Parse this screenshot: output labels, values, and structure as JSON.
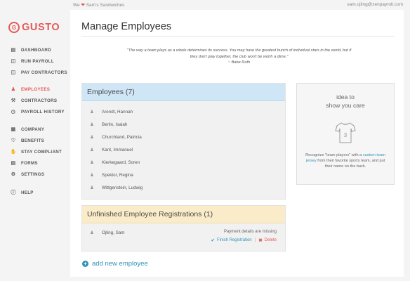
{
  "topbar": {
    "company_prefix": "We",
    "heart_icon": "heart-icon",
    "company_name": "Sam's Sandwiches",
    "user_email": "sam.ojling@zenpayroll.com"
  },
  "brand": {
    "logo_mark": "G",
    "logo_text": "GUSTO",
    "color": "#e45a57"
  },
  "sidebar": {
    "items": [
      {
        "label": "DASHBOARD",
        "icon": "dashboard-icon"
      },
      {
        "label": "RUN PAYROLL",
        "icon": "money-icon"
      },
      {
        "label": "PAY CONTRACTORS",
        "icon": "money-icon"
      },
      {
        "label": "EMPLOYEES",
        "icon": "person-icon",
        "active": true
      },
      {
        "label": "CONTRACTORS",
        "icon": "wrench-icon"
      },
      {
        "label": "PAYROLL HISTORY",
        "icon": "clock-icon"
      },
      {
        "label": "COMPANY",
        "icon": "building-icon"
      },
      {
        "label": "BENEFITS",
        "icon": "benefits-icon"
      },
      {
        "label": "STAY COMPLIANT",
        "icon": "thumbs-up-icon"
      },
      {
        "label": "FORMS",
        "icon": "forms-icon"
      },
      {
        "label": "SETTINGS",
        "icon": "gear-icon"
      },
      {
        "label": "HELP",
        "icon": "help-icon"
      }
    ]
  },
  "main": {
    "title": "Manage Employees",
    "quote_text": "\"The way a team plays as a whole determines its success. You may have the greatest bunch of individual stars in the world, but if they don't play together, the club won't be worth a dime.\"",
    "quote_attr": "~ Babe Ruth"
  },
  "employees": {
    "header": "Employees (7)",
    "list": [
      "Arendt, Hannah",
      "Berlin, Isaiah",
      "Churchland, Patricia",
      "Kant, Immanuel",
      "Kierkegaard, Soren",
      "Spektor, Regina",
      "Wittgenstein, Ludwig"
    ],
    "header_color": "#cfe6f7"
  },
  "registrations": {
    "header": "Unfinished Employee Registrations (1)",
    "header_color": "#fbecc9",
    "rows": [
      {
        "name": "Ojling, Sam",
        "status": "Payment details are missing",
        "finish_label": "Finish Registration",
        "separator": "|",
        "delete_label": "Delete"
      }
    ]
  },
  "add_employee": {
    "label": "add new employee"
  },
  "idea": {
    "title_line1": "idea to",
    "title_line2": "show you care",
    "icon": "jersey-icon",
    "jersey_number": "3",
    "text_before": "Recognize \"team players\" with a ",
    "link_text": "custom team jersey",
    "text_after": " from their favorite sports team, and put their name on the back."
  },
  "colors": {
    "accent": "#e45a57",
    "link": "#2f93b8"
  }
}
